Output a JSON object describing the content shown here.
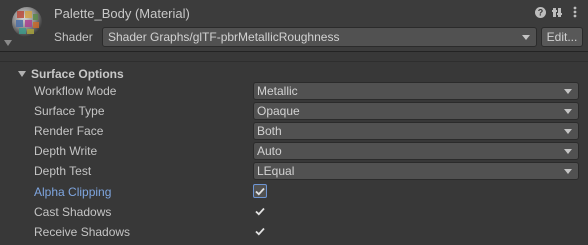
{
  "header": {
    "title": "Palette_Body (Material)",
    "shader_label": "Shader",
    "shader_value": "Shader Graphs/glTF-pbrMetallicRoughness",
    "edit_label": "Edit...",
    "icons": [
      "help-icon",
      "preset-icon",
      "more-icon"
    ]
  },
  "surface_options": {
    "title": "Surface Options",
    "rows": [
      {
        "label": "Workflow Mode",
        "value": "Metallic",
        "kind": "dropdown"
      },
      {
        "label": "Surface Type",
        "value": "Opaque",
        "kind": "dropdown"
      },
      {
        "label": "Render Face",
        "value": "Both",
        "kind": "dropdown"
      },
      {
        "label": "Depth Write",
        "value": "Auto",
        "kind": "dropdown"
      },
      {
        "label": "Depth Test",
        "value": "LEqual",
        "kind": "dropdown"
      },
      {
        "label": "Alpha Clipping",
        "checked": true,
        "kind": "checkbox"
      },
      {
        "label": "Cast Shadows",
        "checked": true,
        "kind": "checkbox"
      },
      {
        "label": "Receive Shadows",
        "checked": true,
        "kind": "checkbox"
      }
    ]
  },
  "colors": {
    "background": "#383838",
    "highlight_label": "#7fa6e0"
  }
}
